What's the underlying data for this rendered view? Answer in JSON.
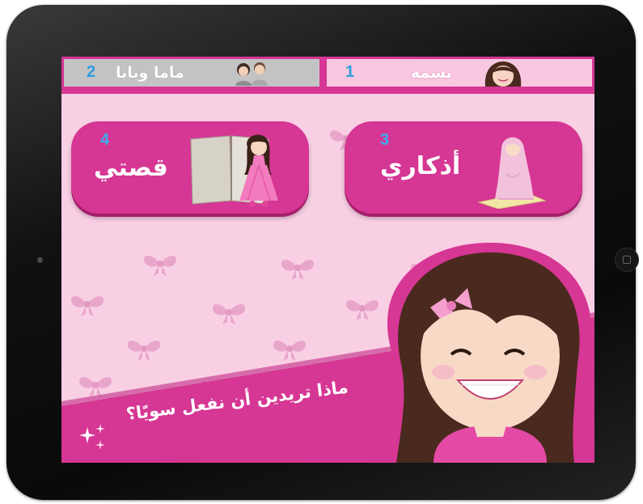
{
  "tabs": [
    {
      "number": "1",
      "label": "بسمة"
    },
    {
      "number": "2",
      "label": "ماما وبابا"
    }
  ],
  "menu": [
    {
      "number": "3",
      "label": "أذكاري"
    },
    {
      "number": "4",
      "label": "قصتي"
    }
  ],
  "prompt": "ماذا تريدين أن نفعل سويًا؟",
  "colors": {
    "brand_pink": "#d63694",
    "light_pink": "#f9cfe4",
    "number_blue": "#2b9de0",
    "inactive_tab": "#c3c3c3"
  },
  "icons": [
    "girl-avatar-icon",
    "parents-icon",
    "praying-girl-icon",
    "storybook-icon",
    "sparkle-icon",
    "bow-pattern"
  ]
}
